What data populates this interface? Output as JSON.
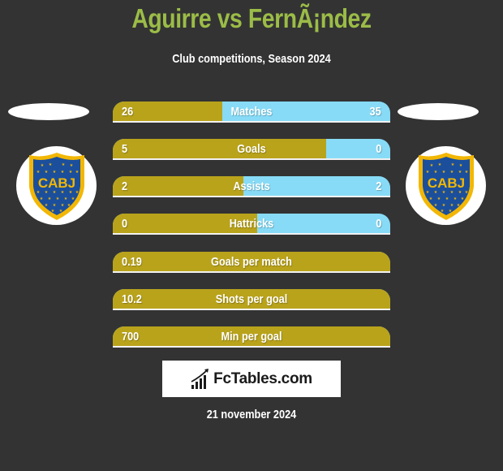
{
  "header": {
    "title": "Aguirre vs FernÃ¡ndez",
    "subtitle": "Club competitions, Season 2024"
  },
  "teams": {
    "left": {
      "crest_icon": "cabj-crest-icon",
      "crest_text": "CABJ"
    },
    "right": {
      "crest_icon": "cabj-crest-icon",
      "crest_text": "CABJ"
    }
  },
  "colors": {
    "left_bar": "#b9a31b",
    "right_bar": "#87dbf6",
    "title": "#9bbc47",
    "background": "#333333"
  },
  "stats": [
    {
      "label": "Matches",
      "left": "26",
      "right": "35",
      "left_share": 0.395
    },
    {
      "label": "Goals",
      "left": "5",
      "right": "0",
      "left_share": 0.77
    },
    {
      "label": "Assists",
      "left": "2",
      "right": "2",
      "left_share": 0.47
    },
    {
      "label": "Hattricks",
      "left": "0",
      "right": "0",
      "left_share": 0.52
    },
    {
      "label": "Goals per match",
      "left": "0.19",
      "right": "",
      "left_share": 1.0
    },
    {
      "label": "Shots per goal",
      "left": "10.2",
      "right": "",
      "left_share": 1.0
    },
    {
      "label": "Min per goal",
      "left": "700",
      "right": "",
      "left_share": 1.0
    }
  ],
  "brand": {
    "icon": "bar-chart-icon",
    "text": "FcTables.com"
  },
  "footer": {
    "date": "21 november 2024"
  }
}
